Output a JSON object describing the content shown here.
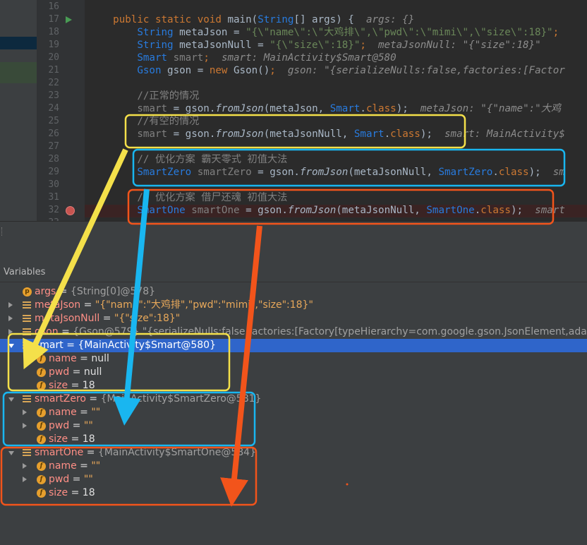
{
  "editor": {
    "lines": [
      {
        "num": "16",
        "tokens": []
      },
      {
        "num": "17",
        "tokens": [
          {
            "t": "    public static void ",
            "c": "kw"
          },
          {
            "t": "main(",
            "c": ""
          },
          {
            "t": "String",
            "c": "cls"
          },
          {
            "t": "[] args) {  ",
            "c": ""
          },
          {
            "t": "args: {}",
            "c": "hint"
          }
        ]
      },
      {
        "num": "18",
        "tokens": [
          {
            "t": "        String ",
            "c": "cls"
          },
          {
            "t": "metaJson = ",
            "c": ""
          },
          {
            "t": "\"{\\\"name\\\":\\\"大鸡排\\\",\\\"pwd\\\":\\\"mimi\\\",\\\"size\\\":18}\"",
            "c": "str"
          },
          {
            "t": ";",
            "c": "kw"
          }
        ]
      },
      {
        "num": "19",
        "tokens": [
          {
            "t": "        String ",
            "c": "cls"
          },
          {
            "t": "metaJsonNull = ",
            "c": ""
          },
          {
            "t": "\"{\\\"size\\\":18}\"",
            "c": "str"
          },
          {
            "t": ";  ",
            "c": "kw"
          },
          {
            "t": "metaJsonNull: \"{\"size\":18}\"",
            "c": "hint"
          }
        ]
      },
      {
        "num": "20",
        "tokens": [
          {
            "t": "        Smart ",
            "c": "cls"
          },
          {
            "t": "smart",
            "c": "cmt"
          },
          {
            "t": ";  ",
            "c": "kw"
          },
          {
            "t": "smart: MainActivity$Smart@580",
            "c": "hint"
          }
        ]
      },
      {
        "num": "21",
        "tokens": [
          {
            "t": "        Gson ",
            "c": "cls"
          },
          {
            "t": "gson = ",
            "c": ""
          },
          {
            "t": "new ",
            "c": "kw"
          },
          {
            "t": "Gson()",
            "c": ""
          },
          {
            "t": ";  ",
            "c": "kw"
          },
          {
            "t": "gson: \"{serializeNulls:false,factories:[Factor",
            "c": "hint"
          }
        ]
      },
      {
        "num": "22",
        "tokens": []
      },
      {
        "num": "23",
        "tokens": [
          {
            "t": "        //正常的情况",
            "c": "cmt"
          }
        ]
      },
      {
        "num": "24",
        "tokens": [
          {
            "t": "        smart",
            "c": "cmt"
          },
          {
            "t": " = gson.",
            "c": ""
          },
          {
            "t": "fromJson",
            "c": "ital"
          },
          {
            "t": "(metaJson, ",
            "c": ""
          },
          {
            "t": "Smart",
            "c": "cls"
          },
          {
            "t": ".",
            "c": ""
          },
          {
            "t": "class",
            "c": "kw"
          },
          {
            "t": ");  ",
            "c": ""
          },
          {
            "t": "metaJson: \"{\"name\":\"大鸡",
            "c": "hint"
          }
        ]
      },
      {
        "num": "25",
        "tokens": [
          {
            "t": "        //有空的情况",
            "c": "cmt"
          }
        ]
      },
      {
        "num": "26",
        "tokens": [
          {
            "t": "        smart",
            "c": "cmt"
          },
          {
            "t": " = gson.",
            "c": ""
          },
          {
            "t": "fromJson",
            "c": "ital"
          },
          {
            "t": "(metaJsonNull, ",
            "c": ""
          },
          {
            "t": "Smart",
            "c": "cls"
          },
          {
            "t": ".",
            "c": ""
          },
          {
            "t": "class",
            "c": "kw"
          },
          {
            "t": ");  ",
            "c": ""
          },
          {
            "t": "smart: MainActivity$",
            "c": "hint"
          }
        ]
      },
      {
        "num": "27",
        "tokens": []
      },
      {
        "num": "28",
        "tokens": [
          {
            "t": "        // 优化方案 霸天零式 初值大法",
            "c": "cmt"
          }
        ]
      },
      {
        "num": "29",
        "tokens": [
          {
            "t": "        SmartZero ",
            "c": "cls"
          },
          {
            "t": "smartZero",
            "c": "cmt"
          },
          {
            "t": " = gson.",
            "c": ""
          },
          {
            "t": "fromJson",
            "c": "ital"
          },
          {
            "t": "(metaJsonNull, ",
            "c": ""
          },
          {
            "t": "SmartZero",
            "c": "cls"
          },
          {
            "t": ".",
            "c": ""
          },
          {
            "t": "class",
            "c": "kw"
          },
          {
            "t": ");  ",
            "c": ""
          },
          {
            "t": "sm",
            "c": "hint"
          }
        ]
      },
      {
        "num": "30",
        "tokens": []
      },
      {
        "num": "31",
        "tokens": [
          {
            "t": "        // 优化方案 借尸还魂 初值大法",
            "c": "cmt"
          }
        ]
      },
      {
        "num": "32",
        "tokens": [
          {
            "t": "        SmartOne ",
            "c": "cls"
          },
          {
            "t": "smartOne",
            "c": "cmt"
          },
          {
            "t": " = gson.",
            "c": ""
          },
          {
            "t": "fromJson",
            "c": "ital"
          },
          {
            "t": "(metaJsonNull, ",
            "c": ""
          },
          {
            "t": "SmartOne",
            "c": "cls"
          },
          {
            "t": ".",
            "c": ""
          },
          {
            "t": "class",
            "c": "kw"
          },
          {
            "t": ");  ",
            "c": ""
          },
          {
            "t": "smart",
            "c": "hint"
          }
        ]
      },
      {
        "num": "33",
        "tokens": []
      }
    ]
  },
  "variables": {
    "title": "Variables",
    "rows": [
      {
        "indent": 0,
        "toggle": "none",
        "icon": "param",
        "name": "args",
        "eq": " = ",
        "value": "{String[0]@578}",
        "vclass": "vt"
      },
      {
        "indent": 0,
        "toggle": "right",
        "icon": "obj",
        "name": "metaJson",
        "eq": " = ",
        "value": "\"{\"name\":\"大鸡排\",\"pwd\":\"mimi\",\"size\":18}\"",
        "vclass": "vstr"
      },
      {
        "indent": 0,
        "toggle": "right",
        "icon": "obj",
        "name": "metaJsonNull",
        "eq": " = ",
        "value": "\"{\"size\":18}\"",
        "vclass": "vstr"
      },
      {
        "indent": 0,
        "toggle": "right",
        "icon": "obj",
        "name": "gson",
        "eq": " = ",
        "value": "{Gson@579} \"{serializeNulls:false,factories:[Factory[typeHierarchy=com.google.gson.JsonElement,adap",
        "vclass": "vt"
      },
      {
        "indent": 0,
        "toggle": "down",
        "icon": "obj",
        "name": "smart",
        "eq": " = ",
        "value": "{MainActivity$Smart@580}",
        "vclass": "vv",
        "selected": true
      },
      {
        "indent": 1,
        "toggle": "none",
        "icon": "field",
        "name": "name",
        "eq": " = ",
        "value": "null",
        "vclass": "vv"
      },
      {
        "indent": 1,
        "toggle": "none",
        "icon": "field",
        "name": "pwd",
        "eq": " = ",
        "value": "null",
        "vclass": "vv"
      },
      {
        "indent": 1,
        "toggle": "none",
        "icon": "field",
        "name": "size",
        "eq": " = ",
        "value": "18",
        "vclass": "vv"
      },
      {
        "indent": 0,
        "toggle": "down",
        "icon": "obj",
        "name": "smartZero",
        "eq": " = ",
        "value": "{MainActivity$SmartZero@581}",
        "vclass": "vt"
      },
      {
        "indent": 1,
        "toggle": "right",
        "icon": "field",
        "name": "name",
        "eq": " = ",
        "value": "\"\"",
        "vclass": "vstr"
      },
      {
        "indent": 1,
        "toggle": "right",
        "icon": "field",
        "name": "pwd",
        "eq": " = ",
        "value": "\"\"",
        "vclass": "vstr"
      },
      {
        "indent": 1,
        "toggle": "none",
        "icon": "field",
        "name": "size",
        "eq": " = ",
        "value": "18",
        "vclass": "vv"
      },
      {
        "indent": 0,
        "toggle": "down",
        "icon": "obj",
        "name": "smartOne",
        "eq": " = ",
        "value": "{MainActivity$SmartOne@584}",
        "vclass": "vt"
      },
      {
        "indent": 1,
        "toggle": "right",
        "icon": "field",
        "name": "name",
        "eq": " = ",
        "value": "\"\"",
        "vclass": "vstr"
      },
      {
        "indent": 1,
        "toggle": "right",
        "icon": "field",
        "name": "pwd",
        "eq": " = ",
        "value": "\"\"",
        "vclass": "vstr"
      },
      {
        "indent": 1,
        "toggle": "none",
        "icon": "field",
        "name": "size",
        "eq": " = ",
        "value": "18",
        "vclass": "vv"
      }
    ]
  },
  "annotation_colors": {
    "yellow": "#f4e04a",
    "blue": "#19b6f0",
    "red": "#f2541b"
  }
}
